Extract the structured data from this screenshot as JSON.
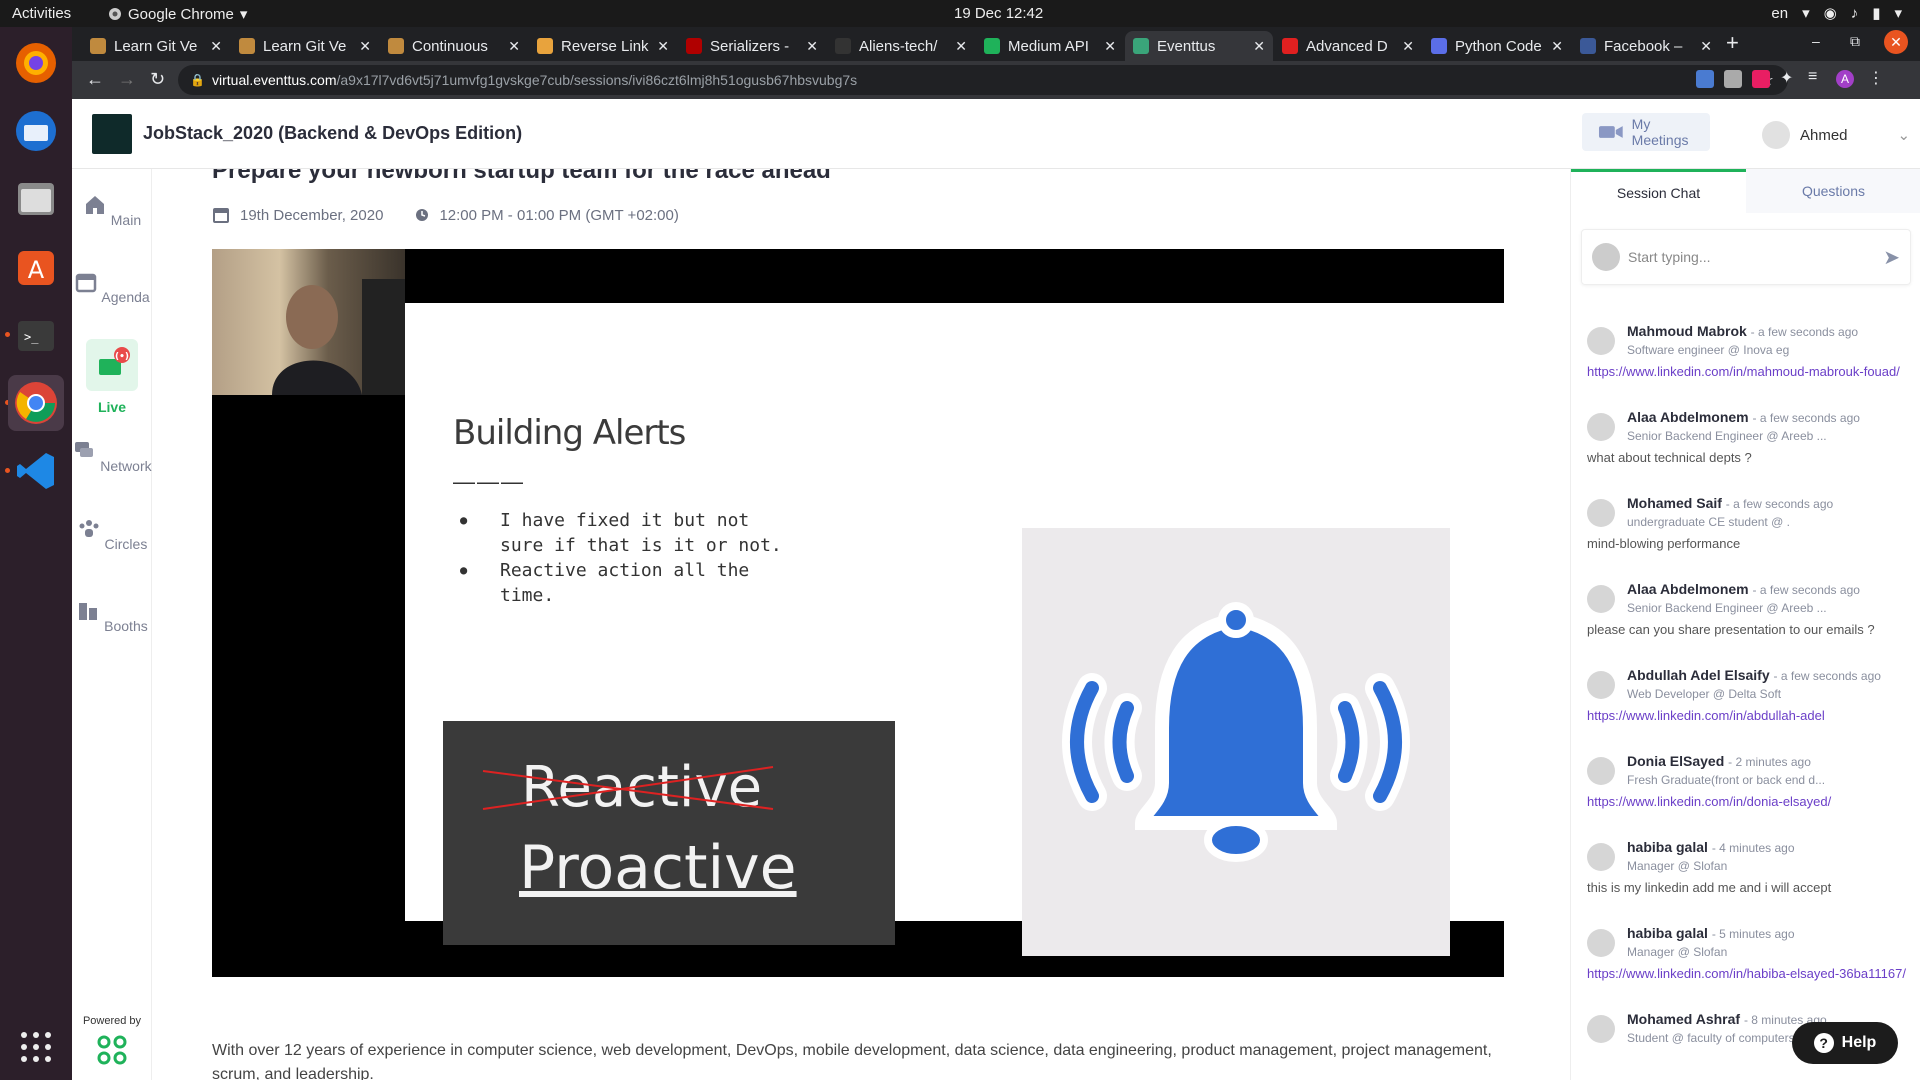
{
  "system": {
    "activities": "Activities",
    "app_name": "Google Chrome",
    "clock": "19 Dec  12:42",
    "lang": "en"
  },
  "tabs": [
    {
      "title": "Learn Git Ve",
      "color": "#c08a3e"
    },
    {
      "title": "Learn Git Ve",
      "color": "#c08a3e"
    },
    {
      "title": "Continuous",
      "color": "#c08a3e"
    },
    {
      "title": "Reverse Link",
      "color": "#e8a33d"
    },
    {
      "title": "Serializers -",
      "color": "#b00000"
    },
    {
      "title": "Aliens-tech/",
      "color": "#333333"
    },
    {
      "title": "Medium API",
      "color": "#1fb25a"
    },
    {
      "title": "Eventtus",
      "color": "#3aa57a"
    },
    {
      "title": "Advanced D",
      "color": "#e02020"
    },
    {
      "title": "Python Code",
      "color": "#5b6ee8"
    },
    {
      "title": "Facebook –",
      "color": "#3b5998"
    }
  ],
  "url": {
    "domain": "virtual.eventtus.com",
    "path": "/a9x17l7vd6vt5j71umvfg1gvskge7cub/sessions/ivi86czt6lmj8h51ogusb67hbsvubg7s"
  },
  "header": {
    "title": "JobStack_2020 (Backend & DevOps Edition)",
    "my_meetings": "My Meetings",
    "user": "Ahmed"
  },
  "nav": {
    "main": "Main",
    "agenda": "Agenda",
    "live": "Live",
    "network": "Network",
    "circles": "Circles",
    "booths": "Booths",
    "powered": "Powered by"
  },
  "session": {
    "title": "Prepare your newborn startup team for the race ahead",
    "date": "19th December, 2020",
    "time": "12:00 PM - 01:00 PM (GMT +02:00)",
    "description": "With over 12 years of experience in computer science, web development, DevOps, mobile development, data science, data engineering, product management, project management, scrum, and leadership."
  },
  "slide": {
    "heading": "Building Alerts",
    "dash": "———",
    "bullet1": "I have fixed it but not sure if that is it or not.",
    "bullet2": "Reactive action all the time.",
    "reactive": "Reactive",
    "proactive": "Proactive"
  },
  "panel": {
    "tab_chat": "Session Chat",
    "tab_questions": "Questions",
    "input_placeholder": "Start typing..."
  },
  "messages": [
    {
      "name": "Mahmoud Mabrok",
      "time": "- a few seconds ago",
      "role": "Software engineer @ Inova eg",
      "text": "https://www.linkedin.com/in/mahmoud-mabrouk-fouad/",
      "link": true
    },
    {
      "name": "Alaa Abdelmonem",
      "time": "- a few seconds ago",
      "role": "Senior Backend Engineer @ Areeb ...",
      "text": "what about technical depts ?",
      "link": false
    },
    {
      "name": "Mohamed Saif",
      "time": "- a few seconds ago",
      "role": "undergraduate CE student @ .",
      "text": "mind-blowing performance",
      "link": false
    },
    {
      "name": "Alaa Abdelmonem",
      "time": "- a few seconds ago",
      "role": "Senior Backend Engineer @ Areeb ...",
      "text": "please can you share presentation to our emails ?",
      "link": false
    },
    {
      "name": "Abdullah Adel Elsaify",
      "time": "- a few seconds ago",
      "role": "Web Developer @ Delta Soft",
      "text": "https://www.linkedin.com/in/abdullah-adel",
      "link": true
    },
    {
      "name": "Donia ElSayed",
      "time": "- 2 minutes ago",
      "role": "Fresh Graduate(front or back end d...",
      "text": "https://www.linkedin.com/in/donia-elsayed/",
      "link": true
    },
    {
      "name": "habiba galal",
      "time": "- 4 minutes ago",
      "role": "Manager @ Slofan",
      "text": "this is my linkedin add me and i will accept",
      "link": false
    },
    {
      "name": "habiba galal",
      "time": "- 5 minutes ago",
      "role": "Manager @ Slofan",
      "text": "https://www.linkedin.com/in/habiba-elsayed-36ba11167/",
      "link": true
    },
    {
      "name": "Mohamed Ashraf",
      "time": "- 8 minutes ago",
      "role": "Student @ faculty of computers an...",
      "text": "",
      "link": false
    }
  ],
  "help": "Help"
}
